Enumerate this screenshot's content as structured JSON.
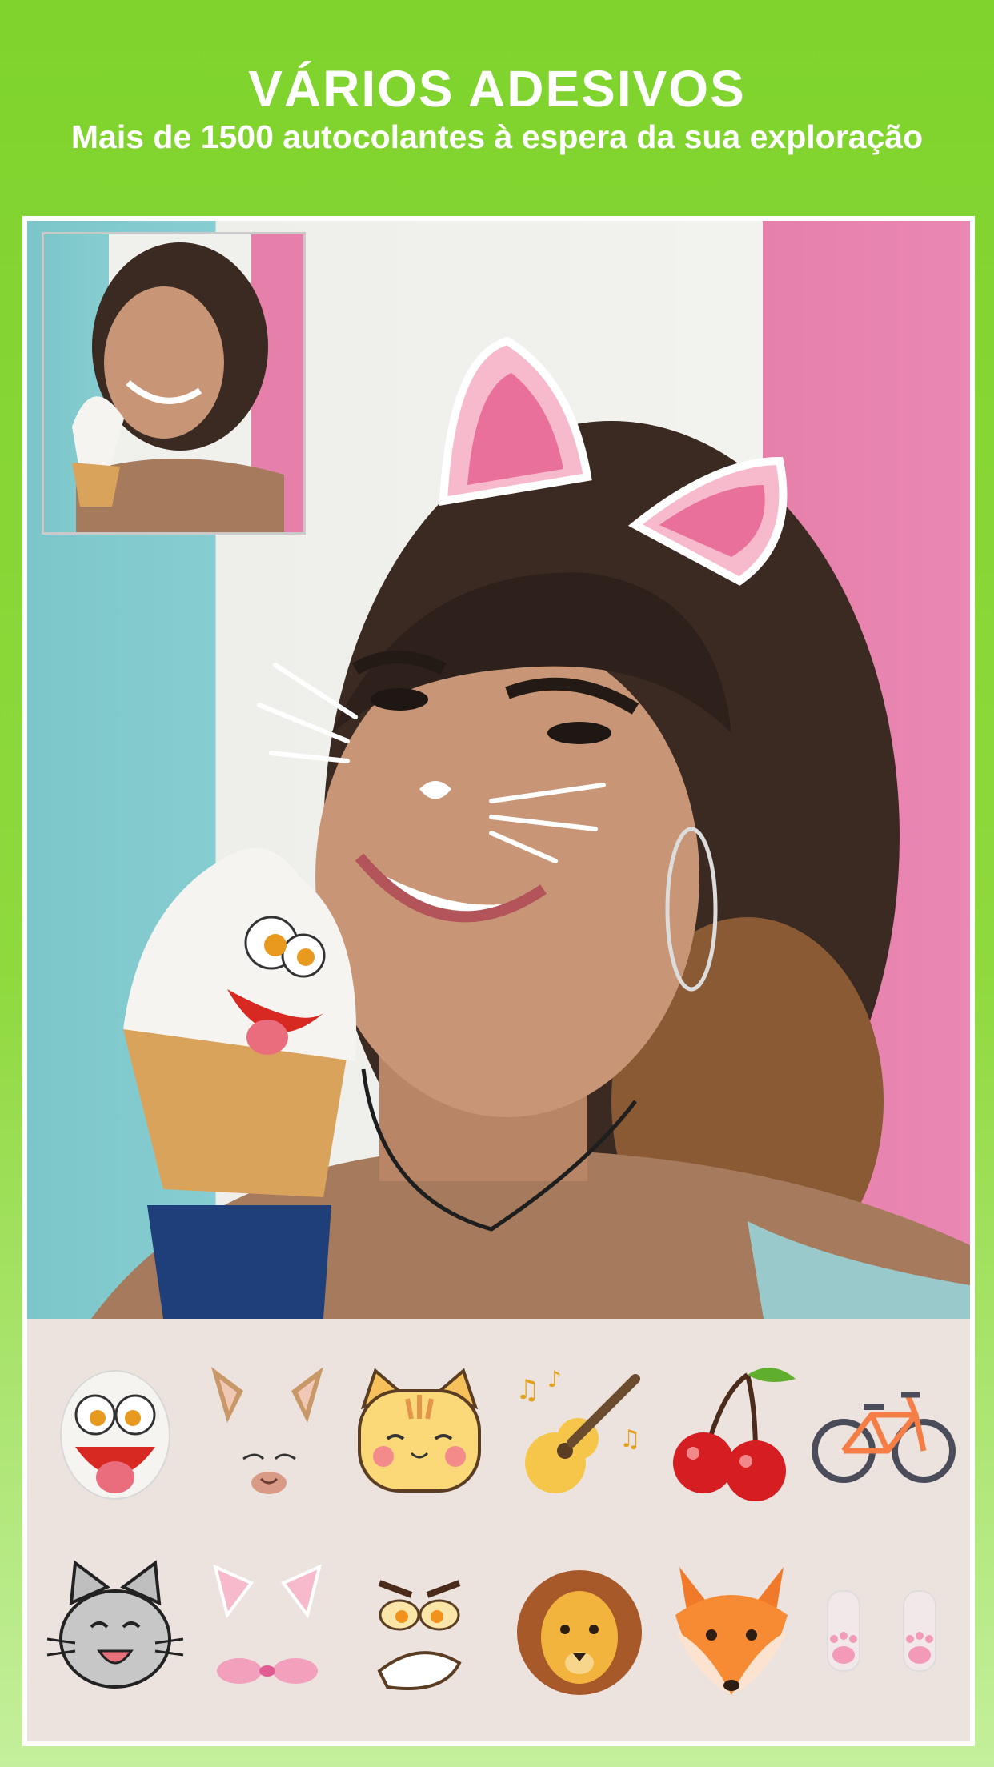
{
  "header": {
    "title": "VÁRIOS ADESIVOS",
    "subtitle": "Mais de 1500 autocolantes à espera da sua exploração"
  },
  "stickers": [
    {
      "name": "goofy-face-sticker"
    },
    {
      "name": "cat-ears-nose-sticker"
    },
    {
      "name": "orange-cat-sticker"
    },
    {
      "name": "guitar-notes-sticker"
    },
    {
      "name": "cherries-sticker"
    },
    {
      "name": "bicycle-sticker"
    },
    {
      "name": "grey-cat-sticker"
    },
    {
      "name": "pink-cat-ears-sticker"
    },
    {
      "name": "angry-face-sticker"
    },
    {
      "name": "lion-sticker"
    },
    {
      "name": "fox-sticker"
    },
    {
      "name": "paws-sticker"
    }
  ],
  "colors": {
    "background": "#7fd32c",
    "tray": "#ece3df",
    "pink": "#e680ab",
    "teal": "#7cc6c9"
  }
}
